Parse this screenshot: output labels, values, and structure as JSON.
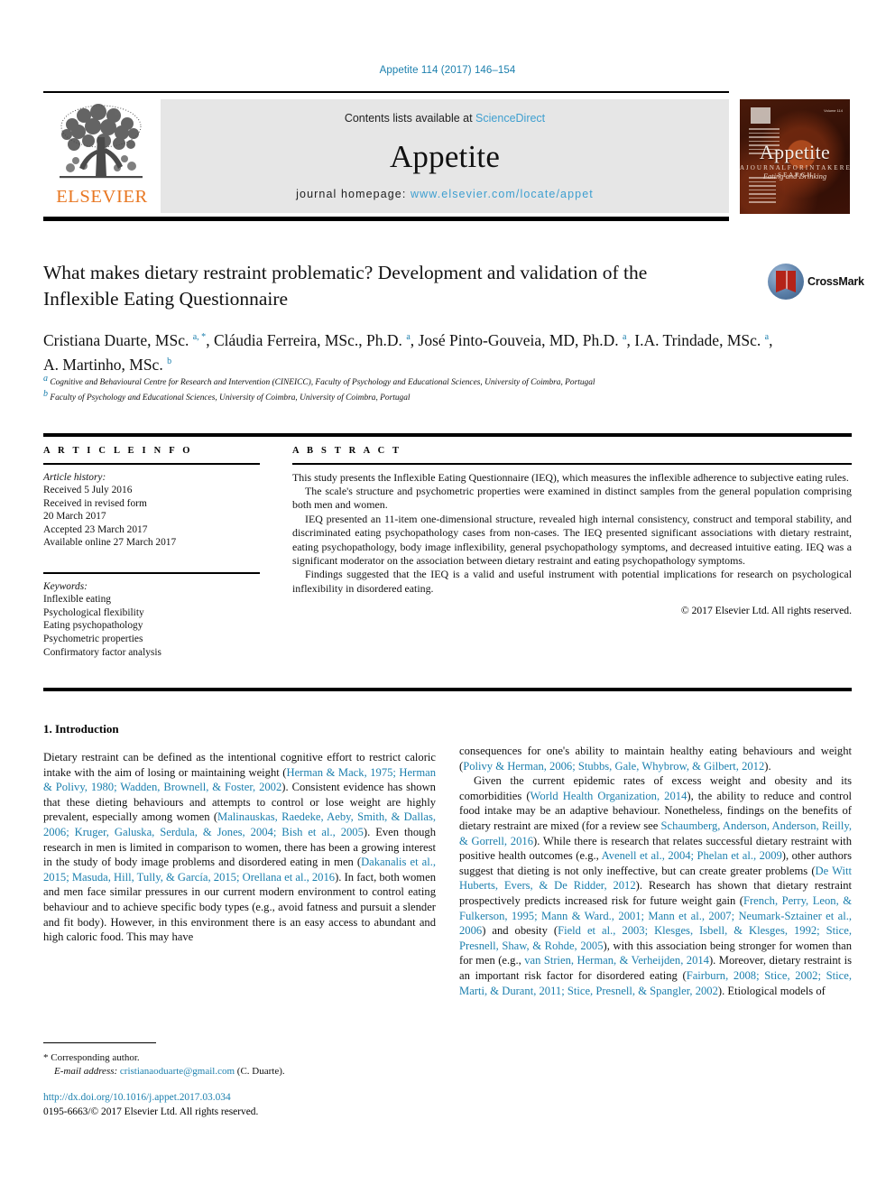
{
  "running_head": "Appetite 114 (2017) 146–154",
  "masthead": {
    "publisher_logo_text": "ELSEVIER",
    "contents_prefix": "Contents lists available at ",
    "contents_link": "ScienceDirect",
    "journal_name": "Appetite",
    "homepage_prefix": "journal homepage: ",
    "homepage_url": "www.elsevier.com/locate/appet",
    "cover": {
      "title": "Appetite",
      "subtitle_small": "A  J O U R N A L  F O R  I N T A K E  R E S E A R C H",
      "subtitle_italic": "Eating and Drinking",
      "corner_note": "Volume 114"
    }
  },
  "article": {
    "title": "What makes dietary restraint problematic? Development and validation of the Inflexible Eating Questionnaire",
    "crossmark_label": "CrossMark",
    "authors": "Cristiana Duarte, MSc. <sup>a, *</sup>, Cláudia Ferreira, MSc., Ph.D. <sup>a</sup>, José Pinto-Gouveia, MD, Ph.D. <sup>a</sup>, I.A. Trindade, MSc. <sup>a</sup>, A. Martinho, MSc. <sup>b</sup>",
    "affiliations": "<sup>a</sup> Cognitive and Behavioural Centre for Research and Intervention (CINEICC), Faculty of Psychology and Educational Sciences, University of Coimbra, Portugal<br><sup>b</sup> Faculty of Psychology and Educational Sciences, University of Coimbra, University of Coimbra, Portugal"
  },
  "article_info": {
    "heading": "A R T I C L E  I N F O",
    "history_label": "Article history:",
    "history_lines": [
      "Received 5 July 2016",
      "Received in revised form",
      "20 March 2017",
      "Accepted 23 March 2017",
      "Available online 27 March 2017"
    ],
    "keywords_label": "Keywords:",
    "keywords": [
      "Inflexible eating",
      "Psychological flexibility",
      "Eating psychopathology",
      "Psychometric properties",
      "Confirmatory factor analysis"
    ]
  },
  "abstract": {
    "heading": "A B S T R A C T",
    "paragraphs": [
      "This study presents the Inflexible Eating Questionnaire (IEQ), which measures the inflexible adherence to subjective eating rules.",
      "The scale's structure and psychometric properties were examined in distinct samples from the general population comprising both men and women.",
      "IEQ presented an 11-item one-dimensional structure, revealed high internal consistency, construct and temporal stability, and discriminated eating psychopathology cases from non-cases. The IEQ presented significant associations with dietary restraint, eating psychopathology, body image inflexibility, general psychopathology symptoms, and decreased intuitive eating. IEQ was a significant moderator on the association between dietary restraint and eating psychopathology symptoms.",
      "Findings suggested that the IEQ is a valid and useful instrument with potential implications for research on psychological inflexibility in disordered eating."
    ],
    "copyright": "© 2017 Elsevier Ltd. All rights reserved."
  },
  "body": {
    "section_heading": "1. Introduction",
    "left_paragraphs": [
      "Dietary restraint can be defined as the intentional cognitive effort to restrict caloric intake with the aim of losing or maintaining weight (<span class=\"ref\">Herman &amp; Mack, 1975; Herman &amp; Polivy, 1980; Wadden, Brownell, &amp; Foster, 2002</span>). Consistent evidence has shown that these dieting behaviours and attempts to control or lose weight are highly prevalent, especially among women (<span class=\"ref\">Malinauskas, Raedeke, Aeby, Smith, &amp; Dallas, 2006; Kruger, Galuska, Serdula, &amp; Jones, 2004; Bish et al., 2005</span>). Even though research in men is limited in comparison to women, there has been a growing interest in the study of body image problems and disordered eating in men (<span class=\"ref\">Dakanalis et al., 2015; Masuda, Hill, Tully, &amp; García, 2015; Orellana et al., 2016</span>). In fact, both women and men face similar pressures in our current modern environment to control eating behaviour and to achieve specific body types (e.g., avoid fatness and pursuit a slender and fit body). However, in this environment there is an easy access to abundant and high caloric food. This may have"
    ],
    "right_paragraphs": [
      "consequences for one's ability to maintain healthy eating behaviours and weight (<span class=\"ref\">Polivy &amp; Herman, 2006; Stubbs, Gale, Whybrow, &amp; Gilbert, 2012</span>).",
      "Given the current epidemic rates of excess weight and obesity and its comorbidities (<span class=\"ref\">World Health Organization, 2014</span>), the ability to reduce and control food intake may be an adaptive behaviour. Nonetheless, findings on the benefits of dietary restraint are mixed (for a review see <span class=\"ref\">Schaumberg, Anderson, Anderson, Reilly, &amp; Gorrell, 2016</span>). While there is research that relates successful dietary restraint with positive health outcomes (e.g., <span class=\"ref\">Avenell et al., 2004; Phelan et al., 2009</span>), other authors suggest that dieting is not only ineffective, but can create greater problems (<span class=\"ref\">De Witt Huberts, Evers, &amp; De Ridder, 2012</span>). Research has shown that dietary restraint prospectively predicts increased risk for future weight gain (<span class=\"ref\">French, Perry, Leon, &amp; Fulkerson, 1995; Mann &amp; Ward., 2001; Mann et al., 2007; Neumark-Sztainer et al., 2006</span>) and obesity (<span class=\"ref\">Field et al., 2003; Klesges, Isbell, &amp; Klesges, 1992; Stice, Presnell, Shaw, &amp; Rohde, 2005</span>), with this association being stronger for women than for men (e.g., <span class=\"ref\">van Strien, Herman, &amp; Verheijden, 2014</span>). Moreover, dietary restraint is an important risk factor for disordered eating (<span class=\"ref\">Fairburn, 2008; Stice, 2002; Stice, Marti, &amp; Durant, 2011; Stice, Presnell, &amp; Spangler, 2002</span>). Etiological models of"
    ]
  },
  "footer": {
    "corresponding_marker": "*",
    "corresponding_label": "Corresponding author.",
    "email_label": "E-mail address:",
    "email": "cristianaoduarte@gmail.com",
    "email_suffix": "(C. Duarte).",
    "doi": "http://dx.doi.org/10.1016/j.appet.2017.03.034",
    "issn_line": "0195-6663/© 2017 Elsevier Ltd. All rights reserved."
  },
  "colors": {
    "link_blue": "#1b7fad",
    "sciencedirect_blue": "#3e9fd0",
    "elsevier_orange": "#e87722",
    "panel_gray": "#e6e6e6"
  }
}
